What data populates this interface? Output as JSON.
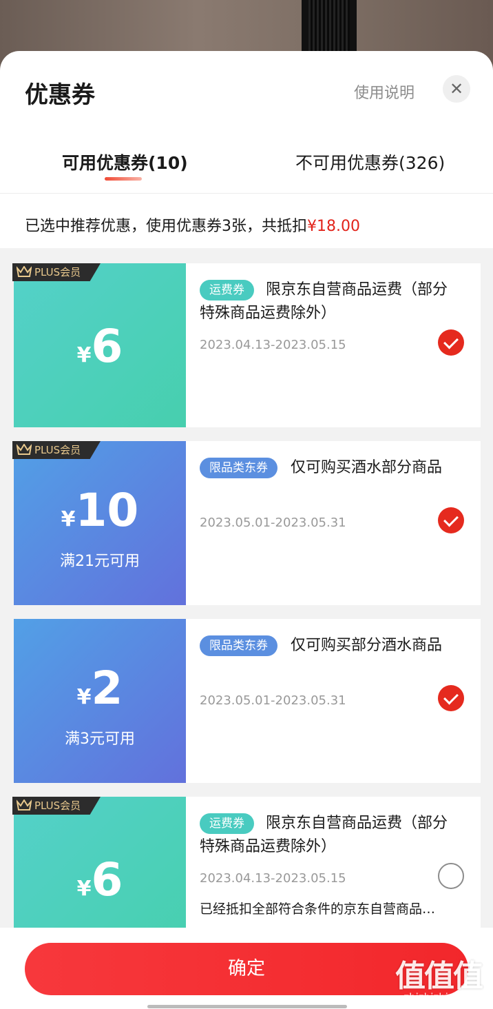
{
  "header": {
    "title": "优惠券",
    "help_label": "使用说明",
    "close_label": "✕"
  },
  "tabs": [
    {
      "label": "可用优惠券(10)",
      "active": true
    },
    {
      "label": "不可用优惠券(326)",
      "active": false
    }
  ],
  "summary": {
    "text": "已选中推荐优惠，使用优惠券3张，共抵扣",
    "amount": "¥18.00"
  },
  "plus_badge": "PLUS会员",
  "currency": "¥",
  "coupons": [
    {
      "plus": true,
      "value": "6",
      "condition": "",
      "tag": "运费券",
      "desc": "限京东自营商品运费（部分特殊商品运费除外）",
      "date": "2023.04.13-2023.05.15",
      "checked": true,
      "note": ""
    },
    {
      "plus": true,
      "value": "10",
      "condition": "满21元可用",
      "tag": "限品类东券",
      "desc": "仅可购买酒水部分商品",
      "date": "2023.05.01-2023.05.31",
      "checked": true,
      "note": ""
    },
    {
      "plus": false,
      "value": "2",
      "condition": "满3元可用",
      "tag": "限品类东券",
      "desc": "仅可购买部分酒水商品",
      "date": "2023.05.01-2023.05.31",
      "checked": true,
      "note": ""
    },
    {
      "plus": true,
      "value": "6",
      "condition": "",
      "tag": "运费券",
      "desc": "限京东自营商品运费（部分特殊商品运费除外）",
      "date": "2023.04.13-2023.05.15",
      "checked": false,
      "note": "已经抵扣全部符合条件的京东自营商品…"
    }
  ],
  "footer": {
    "confirm_label": "确定"
  },
  "watermark": {
    "logo": "值值值",
    "url": "zhizhizhi.com"
  },
  "colors": {
    "accent_red": "#e52a1e",
    "teal": "#49cbc0",
    "blue": "#5b8fe0",
    "confirm": "#f2272b"
  }
}
